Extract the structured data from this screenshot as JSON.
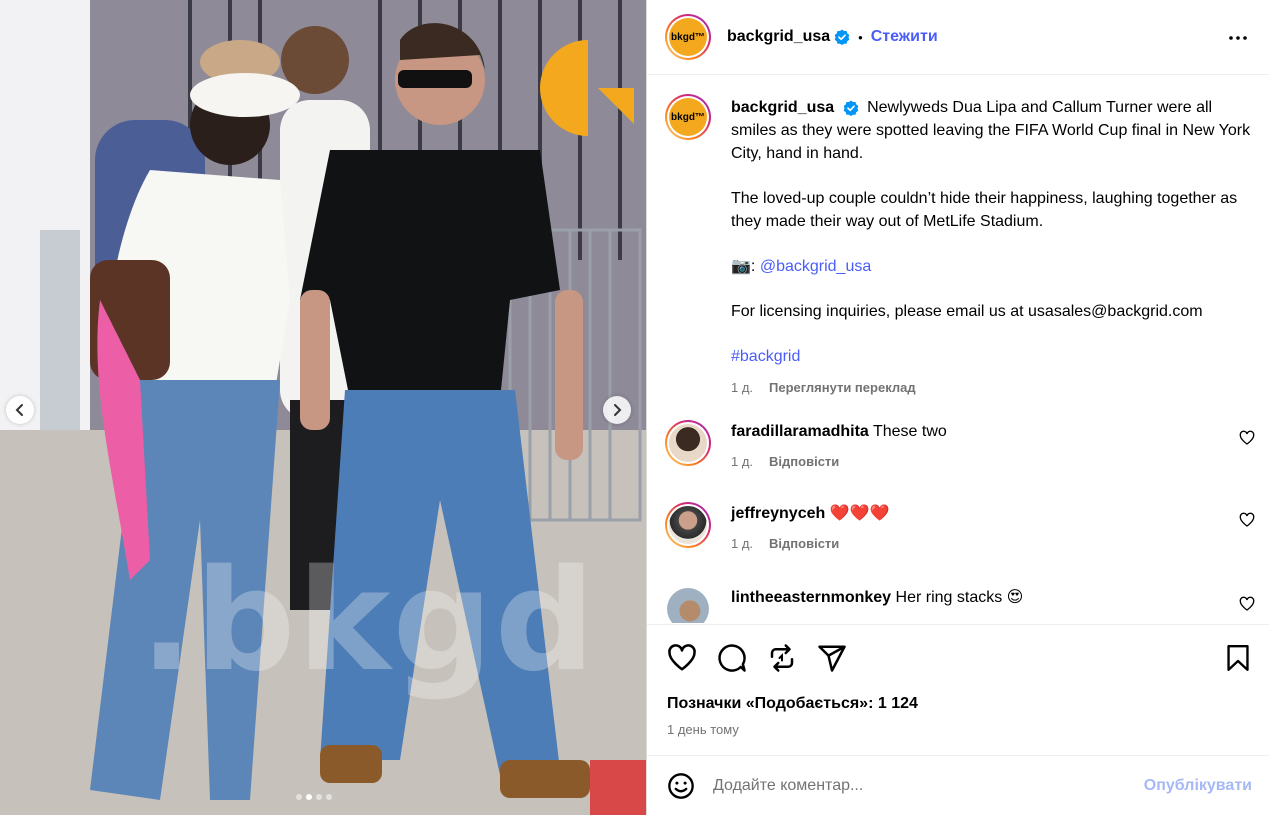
{
  "header": {
    "username": "backgrid_usa",
    "dot": "•",
    "follow_label": "Стежити",
    "avatar_text": "bkgd™"
  },
  "caption": {
    "username": "backgrid_usa",
    "line1": "Newlyweds Dua Lipa and Callum Turner were all smiles as they were spotted leaving the FIFA World Cup final in New York City, hand in hand.",
    "line2": "The loved-up couple couldn’t hide their happiness, laughing together as they made their way out of MetLife Stadium.",
    "camera_emoji": "📷",
    "colon": ":",
    "credit_handle": "@backgrid_usa",
    "line4": "For licensing inquiries, please email us at usasales@backgrid.com",
    "hashtag": "#backgrid",
    "age": "1 д.",
    "translate_label": "Переглянути переклад"
  },
  "comments": [
    {
      "username": "faradillaramadhita",
      "text": "These two",
      "age": "1 д.",
      "reply_label": "Відповісти"
    },
    {
      "username": "jeffreynyceh",
      "text": "❤️❤️❤️",
      "age": "1 д.",
      "reply_label": "Відповісти"
    },
    {
      "username": "lintheeasternmonkey",
      "text": "Her ring stacks 😍"
    }
  ],
  "actions": {
    "likes_label": "Позначки «Подобається»: 1 124",
    "date_label": "1 день тому"
  },
  "add_comment": {
    "placeholder": "Додайте коментар...",
    "post_label": "Опублікувати"
  },
  "carousel": {
    "slide_count": 4,
    "active_index": 1,
    "watermark": ".bkgd"
  },
  "colors": {
    "link_blue": "#4a5df9",
    "verified_blue": "#0095f6",
    "brand_orange": "#f4a81d",
    "post_disabled": "#a6b8f5"
  }
}
